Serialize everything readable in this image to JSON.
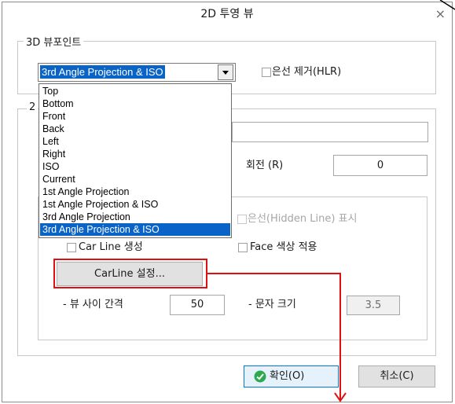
{
  "dialog": {
    "title": "2D 투영 뷰",
    "close_glyph": "×"
  },
  "viewpoint_group": {
    "legend": "3D 뷰포인트",
    "selected_value": "3rd Angle Projection & ISO",
    "hlr_label": "은선 제거(HLR)",
    "hlr_checked": false
  },
  "dropdown": {
    "options": [
      "Top",
      "Bottom",
      "Front",
      "Back",
      "Left",
      "Right",
      "ISO",
      "Current",
      "1st Angle Projection",
      "1st Angle Projection & ISO",
      "3rd Angle Projection",
      "3rd Angle Projection & ISO"
    ],
    "selected_index": 11
  },
  "second_group": {
    "legend_fragment": "2",
    "rotation_label": "회전 (R)",
    "rotation_value": "0",
    "hidden_line_label": "은선(Hidden Line) 표시",
    "carline_create_label": "Car Line 생성",
    "face_color_label": "Face 색상 적용",
    "carline_settings_button": "CarLine 설정...",
    "view_gap_label": "- 뷰 사이 간격",
    "view_gap_value": "50",
    "text_size_label": "- 문자 크기",
    "text_size_value": "3.5"
  },
  "buttons": {
    "ok_label": "확인(O)",
    "cancel_label": "취소(C)"
  },
  "colors": {
    "highlight": "#0a64c8",
    "annotation": "#e01010",
    "ok_icon": "#2fa84f"
  }
}
